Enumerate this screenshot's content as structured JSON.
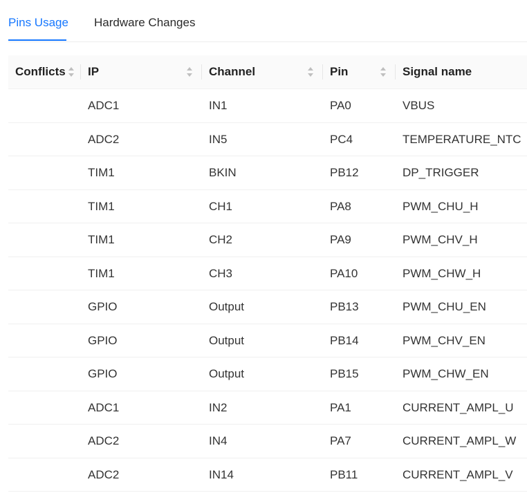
{
  "tabs": [
    {
      "label": "Pins Usage",
      "active": true
    },
    {
      "label": "Hardware Changes",
      "active": false
    }
  ],
  "colors": {
    "accent": "#1677ff"
  },
  "table": {
    "columns": [
      {
        "key": "conflicts",
        "label": "Conflicts",
        "sortable": true
      },
      {
        "key": "ip",
        "label": "IP",
        "sortable": true
      },
      {
        "key": "channel",
        "label": "Channel",
        "sortable": true
      },
      {
        "key": "pin",
        "label": "Pin",
        "sortable": true
      },
      {
        "key": "signal",
        "label": "Signal name",
        "sortable": false
      }
    ],
    "rows": [
      {
        "conflicts": "",
        "ip": "ADC1",
        "channel": "IN1",
        "pin": "PA0",
        "signal": "VBUS"
      },
      {
        "conflicts": "",
        "ip": "ADC2",
        "channel": "IN5",
        "pin": "PC4",
        "signal": "TEMPERATURE_NTC"
      },
      {
        "conflicts": "",
        "ip": "TIM1",
        "channel": "BKIN",
        "pin": "PB12",
        "signal": "DP_TRIGGER"
      },
      {
        "conflicts": "",
        "ip": "TIM1",
        "channel": "CH1",
        "pin": "PA8",
        "signal": "PWM_CHU_H"
      },
      {
        "conflicts": "",
        "ip": "TIM1",
        "channel": "CH2",
        "pin": "PA9",
        "signal": "PWM_CHV_H"
      },
      {
        "conflicts": "",
        "ip": "TIM1",
        "channel": "CH3",
        "pin": "PA10",
        "signal": "PWM_CHW_H"
      },
      {
        "conflicts": "",
        "ip": "GPIO",
        "channel": "Output",
        "pin": "PB13",
        "signal": "PWM_CHU_EN"
      },
      {
        "conflicts": "",
        "ip": "GPIO",
        "channel": "Output",
        "pin": "PB14",
        "signal": "PWM_CHV_EN"
      },
      {
        "conflicts": "",
        "ip": "GPIO",
        "channel": "Output",
        "pin": "PB15",
        "signal": "PWM_CHW_EN"
      },
      {
        "conflicts": "",
        "ip": "ADC1",
        "channel": "IN2",
        "pin": "PA1",
        "signal": "CURRENT_AMPL_U"
      },
      {
        "conflicts": "",
        "ip": "ADC2",
        "channel": "IN4",
        "pin": "PA7",
        "signal": "CURRENT_AMPL_W"
      },
      {
        "conflicts": "",
        "ip": "ADC2",
        "channel": "IN14",
        "pin": "PB11",
        "signal": "CURRENT_AMPL_V"
      }
    ]
  }
}
